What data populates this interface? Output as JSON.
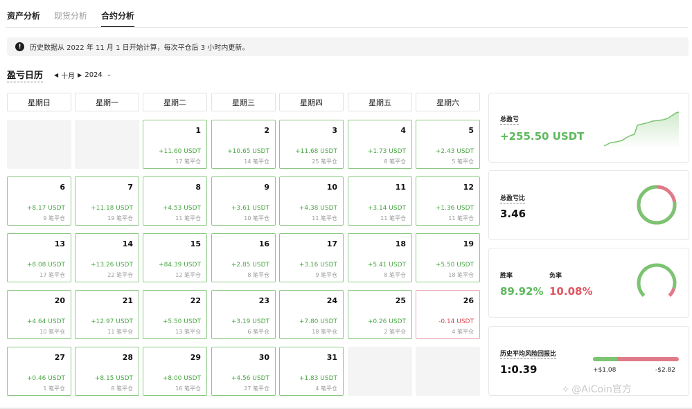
{
  "tabs": [
    {
      "label": "资产分析",
      "active": false
    },
    {
      "label": "现货分析",
      "active": false
    },
    {
      "label": "合约分析",
      "active": true
    }
  ],
  "notice": {
    "icon": "info-icon",
    "icon_glyph": "!",
    "text": "历史数据从 2022 年 11 月 1 日开始计算，每次平仓后 3 小时内更新。"
  },
  "calendar": {
    "title": "盈亏日历",
    "month": "十月",
    "year": "2024",
    "weekdays": [
      "星期日",
      "星期一",
      "星期二",
      "星期三",
      "星期四",
      "星期五",
      "星期六"
    ],
    "leading_blanks": 2,
    "days": [
      {
        "day": "1",
        "pnl": "+11.60 USDT",
        "trades": "17 笔平仓"
      },
      {
        "day": "2",
        "pnl": "+10.65 USDT",
        "trades": "14 笔平仓"
      },
      {
        "day": "3",
        "pnl": "+11.68 USDT",
        "trades": "25 笔平仓"
      },
      {
        "day": "4",
        "pnl": "+1.73 USDT",
        "trades": "8 笔平仓"
      },
      {
        "day": "5",
        "pnl": "+2.43 USDT",
        "trades": "5 笔平仓"
      },
      {
        "day": "6",
        "pnl": "+8.17 USDT",
        "trades": "9 笔平仓"
      },
      {
        "day": "7",
        "pnl": "+11.18 USDT",
        "trades": "19 笔平仓"
      },
      {
        "day": "8",
        "pnl": "+4.53 USDT",
        "trades": "11 笔平仓"
      },
      {
        "day": "9",
        "pnl": "+3.61 USDT",
        "trades": "10 笔平仓"
      },
      {
        "day": "10",
        "pnl": "+4.38 USDT",
        "trades": "11 笔平仓"
      },
      {
        "day": "11",
        "pnl": "+3.14 USDT",
        "trades": "11 笔平仓"
      },
      {
        "day": "12",
        "pnl": "+1.36 USDT",
        "trades": "11 笔平仓"
      },
      {
        "day": "13",
        "pnl": "+8.08 USDT",
        "trades": "17 笔平仓"
      },
      {
        "day": "14",
        "pnl": "+13.26 USDT",
        "trades": "22 笔平仓"
      },
      {
        "day": "15",
        "pnl": "+84.39 USDT",
        "trades": "12 笔平仓"
      },
      {
        "day": "16",
        "pnl": "+2.85 USDT",
        "trades": "8 笔平仓"
      },
      {
        "day": "17",
        "pnl": "+3.16 USDT",
        "trades": "9 笔平仓"
      },
      {
        "day": "18",
        "pnl": "+5.41 USDT",
        "trades": "8 笔平仓"
      },
      {
        "day": "19",
        "pnl": "+5.50 USDT",
        "trades": "18 笔平仓"
      },
      {
        "day": "20",
        "pnl": "+4.64 USDT",
        "trades": "10 笔平仓"
      },
      {
        "day": "21",
        "pnl": "+12.97 USDT",
        "trades": "11 笔平仓"
      },
      {
        "day": "22",
        "pnl": "+5.50 USDT",
        "trades": "13 笔平仓"
      },
      {
        "day": "23",
        "pnl": "+3.19 USDT",
        "trades": "6 笔平仓"
      },
      {
        "day": "24",
        "pnl": "+7.80 USDT",
        "trades": "18 笔平仓"
      },
      {
        "day": "25",
        "pnl": "+0.26 USDT",
        "trades": "2 笔平仓"
      },
      {
        "day": "26",
        "pnl": "-0.14 USDT",
        "trades": "4 笔平仓"
      },
      {
        "day": "27",
        "pnl": "+0.46 USDT",
        "trades": "1 笔平仓"
      },
      {
        "day": "28",
        "pnl": "+8.15 USDT",
        "trades": "8 笔平仓"
      },
      {
        "day": "29",
        "pnl": "+8.00 USDT",
        "trades": "16 笔平仓"
      },
      {
        "day": "30",
        "pnl": "+4.56 USDT",
        "trades": "27 笔平仓"
      },
      {
        "day": "31",
        "pnl": "+1.83 USDT",
        "trades": "4 笔平仓"
      }
    ]
  },
  "stats": {
    "total_pnl": {
      "label": "总盈亏",
      "value": "+255.50 USDT"
    },
    "pnl_ratio": {
      "label": "总盈亏比",
      "value": "3.46",
      "ring_green_fraction": 0.776
    },
    "win_rate": {
      "win_label": "胜率",
      "win_value": "89.92%",
      "loss_label": "负率",
      "loss_value": "10.08%",
      "gauge_win_fraction": 0.8992
    },
    "risk_reward": {
      "label": "历史平均风险回报比",
      "value": "1:0.39",
      "avg_win": "+$1.08",
      "avg_loss": "-$2.82",
      "bar_green_fraction": 0.28
    }
  },
  "colors": {
    "green": "#5cb85c",
    "red": "#e05561",
    "ring_green": "#7cc372",
    "ring_red": "#e07a88"
  },
  "watermark": "@AiCoin官方"
}
